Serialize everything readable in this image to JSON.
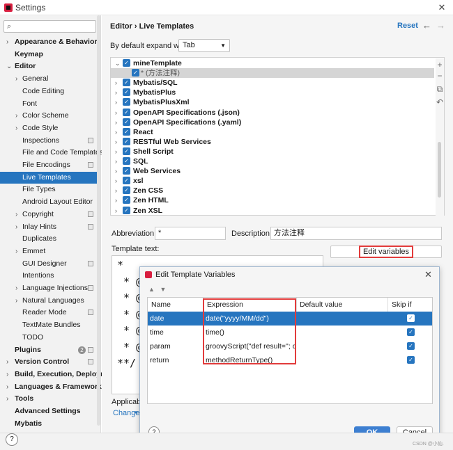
{
  "window": {
    "title": "Settings"
  },
  "search": {
    "placeholder": ""
  },
  "sidebar": {
    "items": [
      {
        "label": "Appearance & Behavior",
        "expanded": false,
        "bold": true
      },
      {
        "label": "Keymap",
        "bold": true
      },
      {
        "label": "Editor",
        "expanded": true,
        "bold": true
      },
      {
        "label": "General",
        "expanded": false
      },
      {
        "label": "Code Editing"
      },
      {
        "label": "Font"
      },
      {
        "label": "Color Scheme",
        "expanded": false
      },
      {
        "label": "Code Style",
        "expanded": false
      },
      {
        "label": "Inspections",
        "settings_icon": true
      },
      {
        "label": "File and Code Templates"
      },
      {
        "label": "File Encodings",
        "settings_icon": true
      },
      {
        "label": "Live Templates",
        "selected": true
      },
      {
        "label": "File Types"
      },
      {
        "label": "Android Layout Editor"
      },
      {
        "label": "Copyright",
        "expanded": false,
        "settings_icon": true
      },
      {
        "label": "Inlay Hints",
        "expanded": false,
        "settings_icon": true
      },
      {
        "label": "Duplicates"
      },
      {
        "label": "Emmet",
        "expanded": false
      },
      {
        "label": "GUI Designer",
        "settings_icon": true
      },
      {
        "label": "Intentions"
      },
      {
        "label": "Language Injections",
        "expanded": false,
        "settings_icon": true
      },
      {
        "label": "Natural Languages",
        "expanded": false
      },
      {
        "label": "Reader Mode",
        "settings_icon": true
      },
      {
        "label": "TextMate Bundles"
      },
      {
        "label": "TODO"
      },
      {
        "label": "Plugins",
        "bold": true,
        "badge": "2",
        "settings_icon": true
      },
      {
        "label": "Version Control",
        "expanded": false,
        "bold": true,
        "settings_icon": true
      },
      {
        "label": "Build, Execution, Deployme",
        "expanded": false,
        "bold": true
      },
      {
        "label": "Languages & Frameworks",
        "expanded": false,
        "bold": true
      },
      {
        "label": "Tools",
        "expanded": false,
        "bold": true
      },
      {
        "label": "Advanced Settings",
        "bold": true
      },
      {
        "label": "Mybatis",
        "bold": true
      }
    ]
  },
  "header": {
    "breadcrumb_parent": "Editor",
    "breadcrumb_current": "Live Templates",
    "reset_label": "Reset"
  },
  "expand": {
    "label": "By default expand with",
    "value": "Tab"
  },
  "template_groups": [
    {
      "label": "mineTemplate",
      "expanded": true,
      "checked": true
    },
    {
      "label": "* (方法注释)",
      "is_template": true,
      "checked": true
    },
    {
      "label": "Mybatis/SQL",
      "checked": true
    },
    {
      "label": "MybatisPlus",
      "checked": true
    },
    {
      "label": "MybatisPlusXml",
      "checked": true
    },
    {
      "label": "OpenAPI Specifications (.json)",
      "checked": true
    },
    {
      "label": "OpenAPI Specifications (.yaml)",
      "checked": true
    },
    {
      "label": "React",
      "checked": true
    },
    {
      "label": "RESTful Web Services",
      "checked": true
    },
    {
      "label": "Shell Script",
      "checked": true
    },
    {
      "label": "SQL",
      "checked": true
    },
    {
      "label": "Web Services",
      "checked": true
    },
    {
      "label": "xsl",
      "checked": true
    },
    {
      "label": "Zen CSS",
      "checked": true
    },
    {
      "label": "Zen HTML",
      "checked": true
    },
    {
      "label": "Zen XSL",
      "checked": true
    }
  ],
  "side_tools": [
    "add-icon",
    "remove-icon",
    "copy-icon",
    "revert-icon"
  ],
  "form": {
    "abbreviation_label": "Abbreviation:",
    "abbreviation_value": "*",
    "description_label": "Description:",
    "description_value": "方法注释",
    "template_text_label": "Template text:",
    "edit_variables_label": "Edit variables",
    "template_lines": [
      "*",
      " * @a",
      " * @d",
      " * @d",
      " * @p",
      " * @r",
      "**/"
    ],
    "applicable_label": "Applicable",
    "change_label": "Change"
  },
  "dialog": {
    "title": "Edit Template Variables",
    "columns": [
      "Name",
      "Expression",
      "Default value",
      "Skip if defined"
    ],
    "rows": [
      {
        "name": "date",
        "expression": "date(\"yyyy/MM/dd\")",
        "default": "",
        "skip": true,
        "selected": true
      },
      {
        "name": "time",
        "expression": "time()",
        "default": "",
        "skip": true
      },
      {
        "name": "param",
        "expression": "groovyScript(\"def result=''; d...",
        "default": "",
        "skip": true
      },
      {
        "name": "return",
        "expression": "methodReturnType()",
        "default": "",
        "skip": true
      }
    ],
    "ok_label": "OK",
    "cancel_label": "Cancel",
    "help_label": "?"
  },
  "footer": {
    "help_label": "?",
    "watermark": "CSDN @小仙."
  },
  "colors": {
    "accent": "#2675bf",
    "highlight_box": "#e23b3b"
  }
}
